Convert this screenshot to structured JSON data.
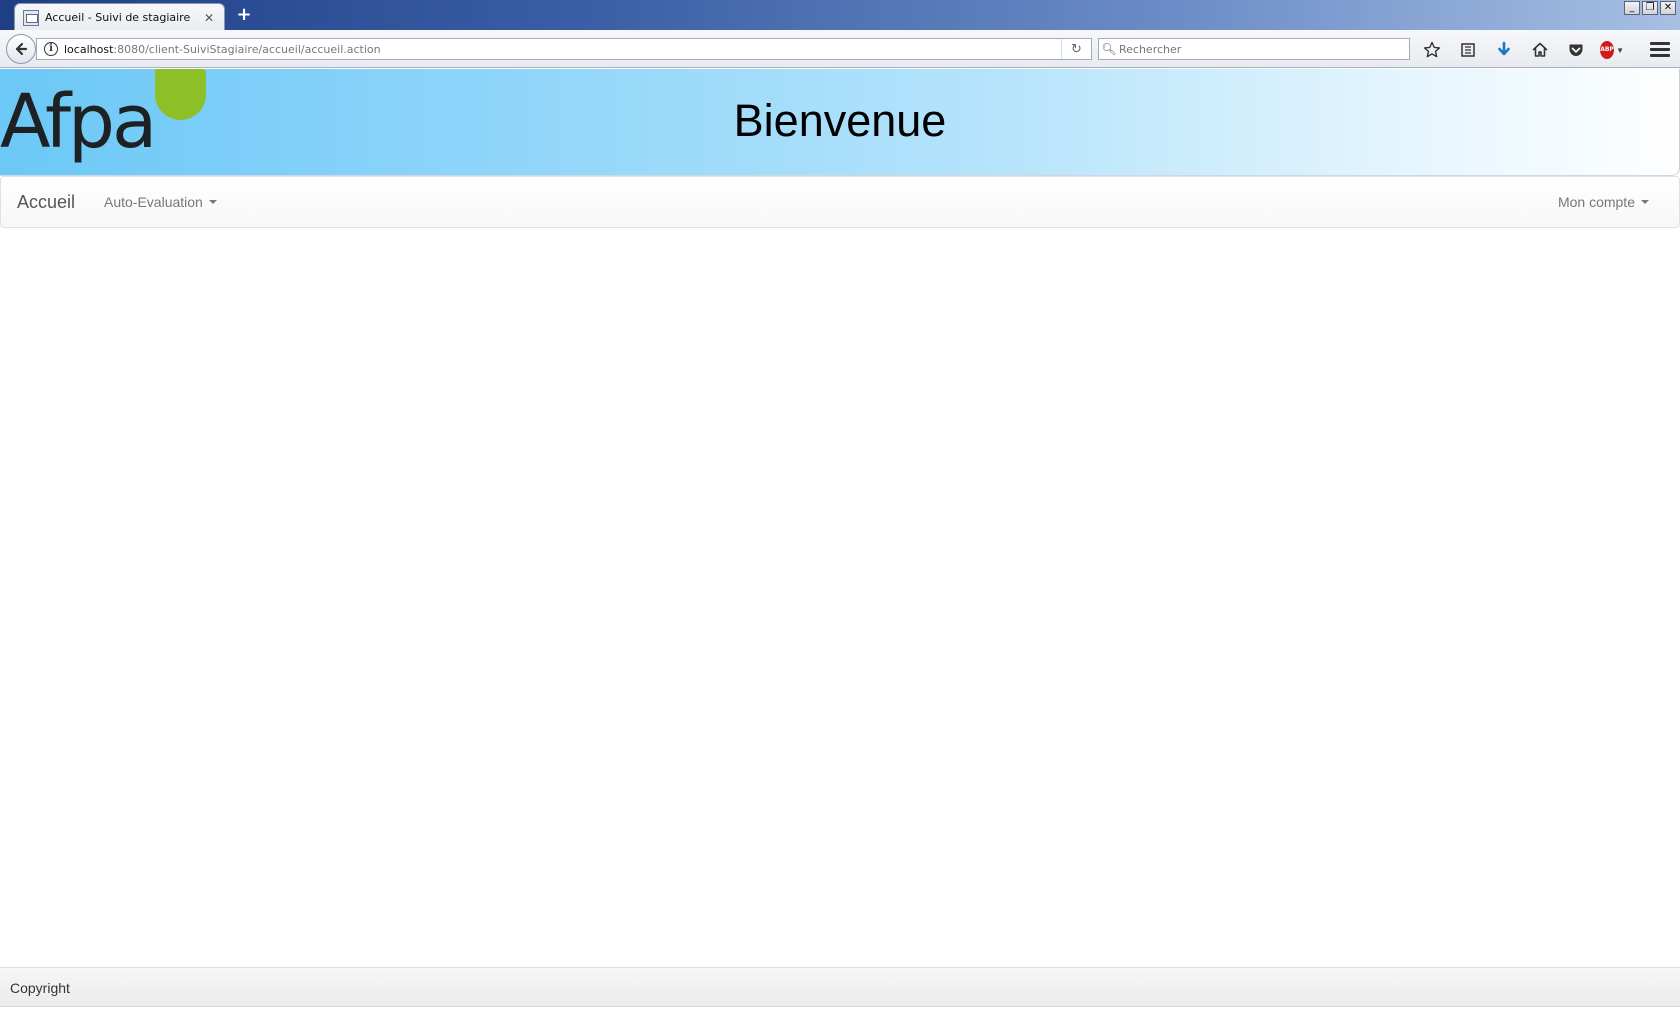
{
  "browser": {
    "tab_title": "Accueil - Suivi de stagiaire",
    "tab_close": "✕",
    "new_tab": "+",
    "url_host": "localhost",
    "url_rest": ":8080/client-SuiviStagiaire/accueil/accueil.action",
    "search_placeholder": "Rechercher",
    "window_buttons": [
      "_",
      "❐",
      "✕"
    ],
    "toolbar_icons": [
      "star-bookmark-icon",
      "reading-list-icon",
      "download-icon",
      "home-icon",
      "pocket-icon",
      "adblock-icon",
      "hamburger-menu-icon"
    ],
    "adblock_label": "ABP"
  },
  "header": {
    "logo_text": "Afpa",
    "title": "Bienvenue"
  },
  "nav": {
    "brand": "Accueil",
    "auto_evaluation": "Auto-Evaluation",
    "mon_compte": "Mon compte"
  },
  "footer": {
    "text": "Copyright"
  },
  "colors": {
    "leaf": "#8dc026",
    "banner_start": "#6cc8f6",
    "banner_end": "#ffffff"
  }
}
